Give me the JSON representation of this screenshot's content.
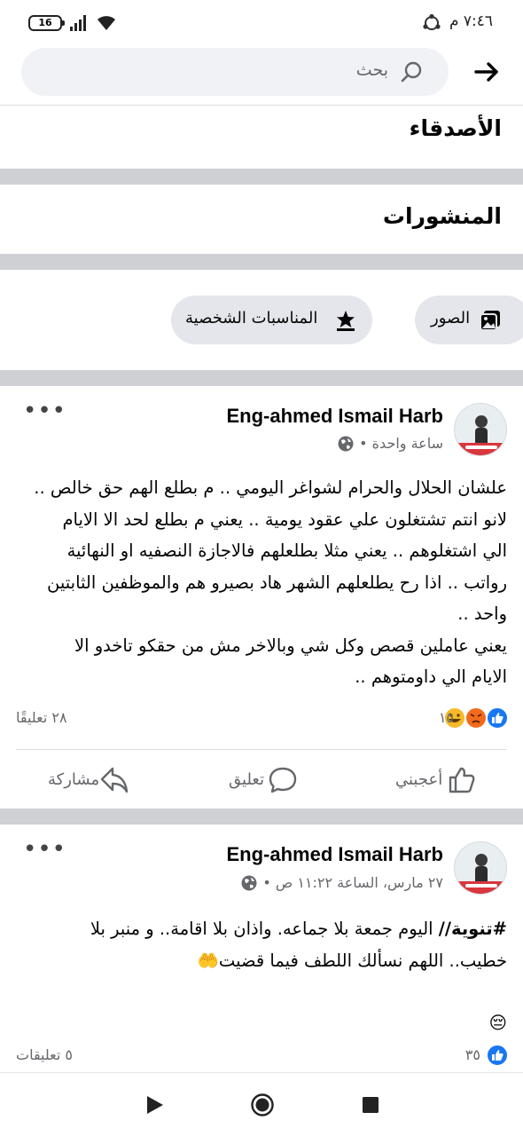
{
  "status_bar": {
    "time": "٧:٤٦ م",
    "battery": "16"
  },
  "search": {
    "placeholder": "بحث"
  },
  "sections": {
    "friends": "الأصدقاء",
    "posts": "المنشورات"
  },
  "filters": [
    {
      "label": "الصور",
      "icon": "photos-icon"
    },
    {
      "label": "المناسبات الشخصية",
      "icon": "star-award-icon"
    }
  ],
  "posts": [
    {
      "author": "Eng-ahmed Ismail Harb",
      "time": "ساعة واحدة •",
      "lines": [
        "علشان الحلال والحرام لشواغر اليومي .. م بطلع الهم حق خالص ..",
        "لانو انتم تشتغلون علي عقود يومية .. يعني م بطلع لحد الا الايام",
        "الي اشتغلوهم .. يعني مثلا بطلعلهم فالاجازة النصفيه او النهائية",
        "رواتب .. اذا رح يطلعلهم الشهر هاد بصيرو هم والموظفين الثابتين",
        "واحد ..",
        "يعني عاملين قصص وكل شي وبالاخر مش من حقكو تاخدو الا",
        "الايام الي داومتوهم .."
      ],
      "reactions_count": "١٥",
      "comments": "٢٨ تعليقًا",
      "actions": {
        "like": "أعجبني",
        "comment": "تعليق",
        "share": "مشاركة"
      }
    },
    {
      "author": "Eng-ahmed Ismail Harb",
      "time": "٢٧ مارس، الساعة ١١:٢٢ ص •",
      "hashtag": "#تنوية//",
      "line1_rest": " اليوم  جمعة بلا جماعه. واذان بلا اقامة..  و منبر بلا",
      "line2": "خطيب..  اللهم نسألك اللطف فيما قضيت",
      "emoji_hands": "🤲",
      "emoji_face": "😔",
      "reactions_count": "٣٥",
      "comments": "٥ تعليقات"
    }
  ],
  "colors": {
    "like_blue": "#1877f2",
    "angry_orange": "#f26b1d",
    "haha_yellow": "#f7b928",
    "separator": "#ced0d4",
    "muted_text": "#65676b"
  }
}
